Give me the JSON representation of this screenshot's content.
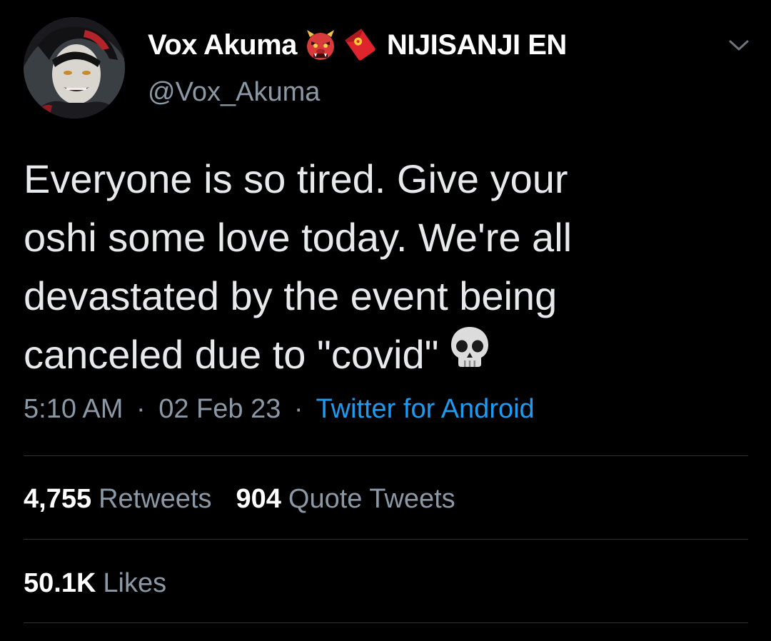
{
  "author": {
    "display_name": "Vox Akuma",
    "org_name": "NIJISANJI EN",
    "handle": "@Vox_Akuma",
    "name_emojis": [
      "ogre-emoji",
      "red-envelope-emoji"
    ]
  },
  "tweet": {
    "lines": [
      "Everyone is so tired. Give your",
      "oshi some love today. We're all",
      "devastated by the event being",
      "canceled due to \"covid\""
    ],
    "trailing_emoji": "skull-emoji",
    "time": "5:10 AM",
    "date": "02 Feb 23",
    "separator": "·",
    "client": "Twitter for Android"
  },
  "stats": {
    "retweets_count": "4,755",
    "retweets_label": "Retweets",
    "quotes_count": "904",
    "quotes_label": "Quote Tweets",
    "likes_count": "50.1K",
    "likes_label": "Likes"
  },
  "colors": {
    "background": "#000000",
    "primary_text": "#e7e9ea",
    "secondary_text": "#8b98a5",
    "link": "#1d9bf0",
    "divider": "#2f3336"
  }
}
